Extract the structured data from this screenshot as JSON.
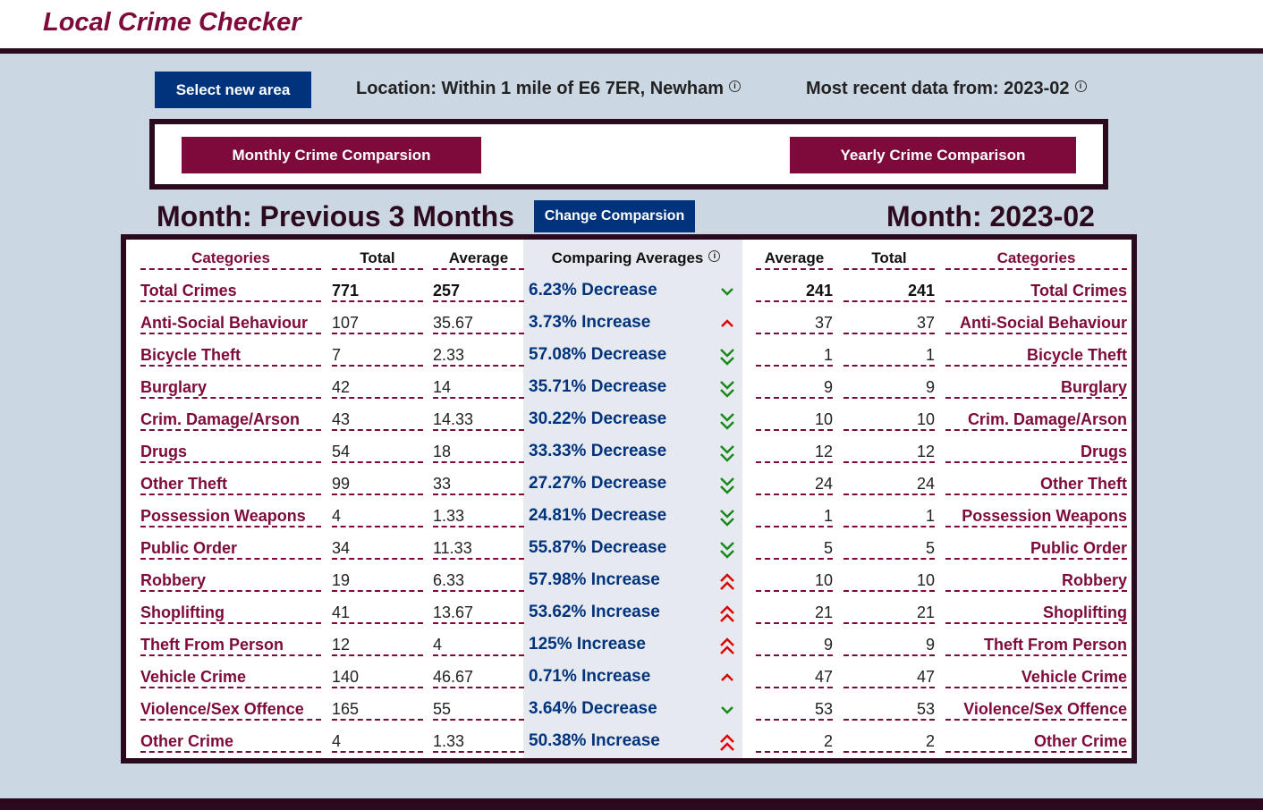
{
  "header": {
    "title": "Local Crime Checker"
  },
  "toolbar": {
    "select_area_label": "Select new area",
    "location_text": "Location: Within 1 mile of E6 7ER, Newham",
    "recent_text": "Most recent data from: 2023-02"
  },
  "comparison_buttons": {
    "monthly": "Monthly Crime Comparsion",
    "yearly": "Yearly Crime Comparison"
  },
  "headings": {
    "left": "Month: Previous 3 Months",
    "change_button": "Change Comparsion",
    "right": "Month: 2023-02"
  },
  "table": {
    "headers": [
      "Categories",
      "Total",
      "Average",
      "Comparing Averages",
      "Average",
      "Total",
      "Categories"
    ],
    "rows": [
      {
        "category": "Total Crimes",
        "prev_total": "771",
        "prev_avg": "257",
        "comparison": "6.23% Decrease",
        "trend": "small-decrease",
        "cur_avg": "241",
        "cur_total": "241",
        "bold": true
      },
      {
        "category": "Anti-Social Behaviour",
        "prev_total": "107",
        "prev_avg": "35.67",
        "comparison": "3.73% Increase",
        "trend": "small-increase",
        "cur_avg": "37",
        "cur_total": "37"
      },
      {
        "category": "Bicycle Theft",
        "prev_total": "7",
        "prev_avg": "2.33",
        "comparison": "57.08% Decrease",
        "trend": "large-decrease",
        "cur_avg": "1",
        "cur_total": "1"
      },
      {
        "category": "Burglary",
        "prev_total": "42",
        "prev_avg": "14",
        "comparison": "35.71% Decrease",
        "trend": "large-decrease",
        "cur_avg": "9",
        "cur_total": "9"
      },
      {
        "category": "Crim. Damage/Arson",
        "prev_total": "43",
        "prev_avg": "14.33",
        "comparison": "30.22% Decrease",
        "trend": "large-decrease",
        "cur_avg": "10",
        "cur_total": "10"
      },
      {
        "category": "Drugs",
        "prev_total": "54",
        "prev_avg": "18",
        "comparison": "33.33% Decrease",
        "trend": "large-decrease",
        "cur_avg": "12",
        "cur_total": "12"
      },
      {
        "category": "Other Theft",
        "prev_total": "99",
        "prev_avg": "33",
        "comparison": "27.27% Decrease",
        "trend": "large-decrease",
        "cur_avg": "24",
        "cur_total": "24"
      },
      {
        "category": "Possession Weapons",
        "prev_total": "4",
        "prev_avg": "1.33",
        "comparison": "24.81% Decrease",
        "trend": "large-decrease",
        "cur_avg": "1",
        "cur_total": "1"
      },
      {
        "category": "Public Order",
        "prev_total": "34",
        "prev_avg": "11.33",
        "comparison": "55.87% Decrease",
        "trend": "large-decrease",
        "cur_avg": "5",
        "cur_total": "5"
      },
      {
        "category": "Robbery",
        "prev_total": "19",
        "prev_avg": "6.33",
        "comparison": "57.98% Increase",
        "trend": "large-increase",
        "cur_avg": "10",
        "cur_total": "10"
      },
      {
        "category": "Shoplifting",
        "prev_total": "41",
        "prev_avg": "13.67",
        "comparison": "53.62% Increase",
        "trend": "large-increase",
        "cur_avg": "21",
        "cur_total": "21"
      },
      {
        "category": "Theft From Person",
        "prev_total": "12",
        "prev_avg": "4",
        "comparison": "125% Increase",
        "trend": "large-increase",
        "cur_avg": "9",
        "cur_total": "9"
      },
      {
        "category": "Vehicle Crime",
        "prev_total": "140",
        "prev_avg": "46.67",
        "comparison": "0.71% Increase",
        "trend": "small-increase",
        "cur_avg": "47",
        "cur_total": "47"
      },
      {
        "category": "Violence/Sex Offence",
        "prev_total": "165",
        "prev_avg": "55",
        "comparison": "3.64% Decrease",
        "trend": "small-decrease",
        "cur_avg": "53",
        "cur_total": "53"
      },
      {
        "category": "Other Crime",
        "prev_total": "4",
        "prev_avg": "1.33",
        "comparison": "50.38% Increase",
        "trend": "large-increase",
        "cur_avg": "2",
        "cur_total": "2"
      }
    ]
  },
  "colors": {
    "maroon": "#7d0a3a",
    "navy": "#00337c",
    "dark": "#2b0a1d",
    "background": "#ccd7e4",
    "decrease_arrow": "#1a8a1a",
    "increase_arrow": "#e00000"
  }
}
